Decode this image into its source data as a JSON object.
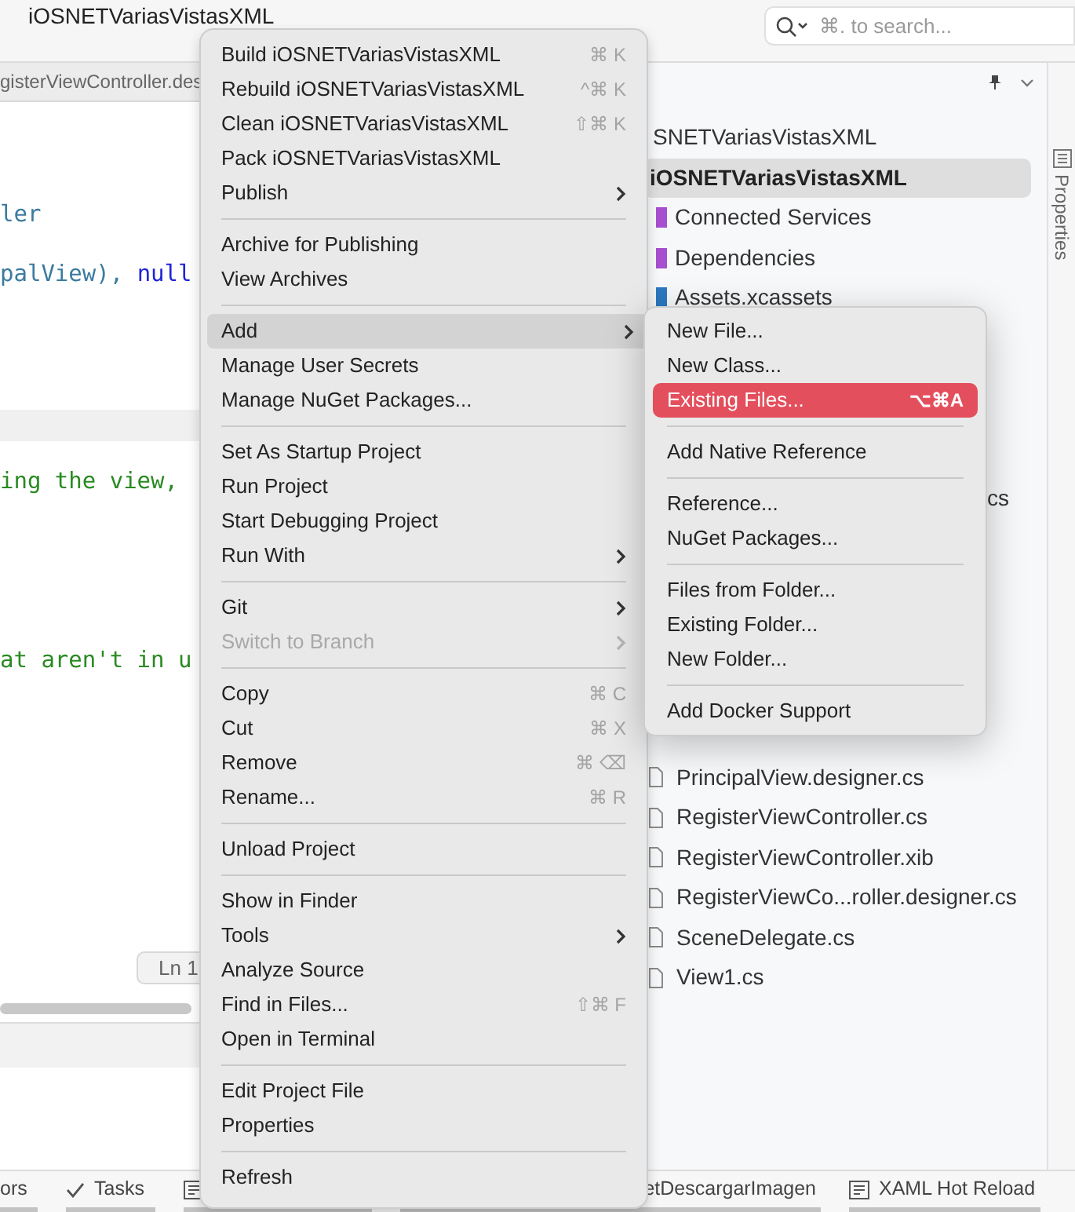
{
  "window": {
    "title": "iOSNETVariasVistasXML"
  },
  "search": {
    "placeholder": "⌘. to search..."
  },
  "editor": {
    "tab": "gisterViewController.des",
    "code_lines": [
      [
        {
          "text": "ler",
          "kind": "type"
        }
      ],
      [
        {
          "text": "palView), ",
          "kind": "type"
        },
        {
          "text": "null",
          "kind": "keyword"
        }
      ],
      [
        {
          "text": "ing the view,",
          "kind": "comment"
        }
      ],
      [
        {
          "text": "at aren't in u",
          "kind": "comment"
        }
      ]
    ],
    "status": "Ln 1"
  },
  "solution": {
    "top": [
      {
        "label": "SNETVariasVistasXML",
        "kind": "root",
        "selected": false
      },
      {
        "label": "iOSNETVariasVistasXML",
        "kind": "project",
        "selected": true
      },
      {
        "label": "Connected Services",
        "kind": "folder",
        "color": "#a64fcf",
        "selected": false
      },
      {
        "label": "Dependencies",
        "kind": "folder",
        "color": "#a64fcf",
        "selected": false
      },
      {
        "label": "Assets.xcassets",
        "kind": "folder",
        "color": "#2c78c0",
        "selected": false
      }
    ],
    "peek": "cs",
    "bottom": [
      {
        "label": "PrincipalView.designer.cs",
        "kind": "file",
        "selected": false
      },
      {
        "label": "RegisterViewController.cs",
        "kind": "file",
        "selected": false
      },
      {
        "label": "RegisterViewController.xib",
        "kind": "file",
        "selected": false
      },
      {
        "label": "RegisterViewCo...roller.designer.cs",
        "kind": "file",
        "selected": false
      },
      {
        "label": "SceneDelegate.cs",
        "kind": "file",
        "selected": false
      },
      {
        "label": "View1.cs",
        "kind": "file",
        "selected": false
      }
    ]
  },
  "properties_label": "Properties",
  "bottom_tabs": [
    {
      "label": "ors",
      "kind": "plain"
    },
    {
      "label": "Tasks",
      "kind": "check"
    },
    {
      "kind": "panel"
    },
    {
      "label": "etDescargarImagen",
      "kind": "plain"
    },
    {
      "label": "XAML Hot Reload",
      "kind": "panel"
    }
  ],
  "context_menu": {
    "items": [
      {
        "kind": "item",
        "label": "Build iOSNETVariasVistasXML",
        "shortcut": "⌘ K",
        "selected": false,
        "disabled": false
      },
      {
        "kind": "item",
        "label": "Rebuild iOSNETVariasVistasXML",
        "shortcut": "^⌘ K",
        "selected": false,
        "disabled": false
      },
      {
        "kind": "item",
        "label": "Clean iOSNETVariasVistasXML",
        "shortcut": "⇧⌘ K",
        "selected": false,
        "disabled": false
      },
      {
        "kind": "item",
        "label": "Pack iOSNETVariasVistasXML",
        "selected": false,
        "disabled": false
      },
      {
        "kind": "item",
        "label": "Publish",
        "submenu": true,
        "selected": false,
        "disabled": false
      },
      {
        "kind": "separator"
      },
      {
        "kind": "item",
        "label": "Archive for Publishing",
        "selected": false,
        "disabled": false
      },
      {
        "kind": "item",
        "label": "View Archives",
        "selected": false,
        "disabled": false
      },
      {
        "kind": "separator"
      },
      {
        "kind": "item",
        "label": "Add",
        "submenu": true,
        "selected": true,
        "disabled": false
      },
      {
        "kind": "item",
        "label": "Manage User Secrets",
        "selected": false,
        "disabled": false
      },
      {
        "kind": "item",
        "label": "Manage NuGet Packages...",
        "selected": false,
        "disabled": false
      },
      {
        "kind": "separator"
      },
      {
        "kind": "item",
        "label": "Set As Startup Project",
        "selected": false,
        "disabled": false
      },
      {
        "kind": "item",
        "label": "Run Project",
        "selected": false,
        "disabled": false
      },
      {
        "kind": "item",
        "label": "Start Debugging Project",
        "selected": false,
        "disabled": false
      },
      {
        "kind": "item",
        "label": "Run With",
        "submenu": true,
        "selected": false,
        "disabled": false
      },
      {
        "kind": "separator"
      },
      {
        "kind": "item",
        "label": "Git",
        "submenu": true,
        "selected": false,
        "disabled": false
      },
      {
        "kind": "item",
        "label": "Switch to Branch",
        "submenu": true,
        "selected": false,
        "disabled": true
      },
      {
        "kind": "separator"
      },
      {
        "kind": "item",
        "label": "Copy",
        "shortcut": "⌘ C",
        "selected": false,
        "disabled": false
      },
      {
        "kind": "item",
        "label": "Cut",
        "shortcut": "⌘ X",
        "selected": false,
        "disabled": false
      },
      {
        "kind": "item",
        "label": "Remove",
        "shortcut": "⌘ ⌫",
        "selected": false,
        "disabled": false
      },
      {
        "kind": "item",
        "label": "Rename...",
        "shortcut": "⌘ R",
        "selected": false,
        "disabled": false
      },
      {
        "kind": "separator"
      },
      {
        "kind": "item",
        "label": "Unload Project",
        "selected": false,
        "disabled": false
      },
      {
        "kind": "separator"
      },
      {
        "kind": "item",
        "label": "Show in Finder",
        "selected": false,
        "disabled": false
      },
      {
        "kind": "item",
        "label": "Tools",
        "submenu": true,
        "selected": false,
        "disabled": false
      },
      {
        "kind": "item",
        "label": "Analyze Source",
        "selected": false,
        "disabled": false
      },
      {
        "kind": "item",
        "label": "Find in Files...",
        "shortcut": "⇧⌘ F",
        "selected": false,
        "disabled": false
      },
      {
        "kind": "item",
        "label": "Open in Terminal",
        "selected": false,
        "disabled": false
      },
      {
        "kind": "separator"
      },
      {
        "kind": "item",
        "label": "Edit Project File",
        "selected": false,
        "disabled": false
      },
      {
        "kind": "item",
        "label": "Properties",
        "selected": false,
        "disabled": false
      },
      {
        "kind": "separator"
      },
      {
        "kind": "item",
        "label": "Refresh",
        "selected": false,
        "disabled": false
      }
    ]
  },
  "submenu": {
    "items": [
      {
        "kind": "item",
        "label": "New File...",
        "selected": false,
        "disabled": false
      },
      {
        "kind": "item",
        "label": "New Class...",
        "selected": false,
        "disabled": false
      },
      {
        "kind": "item",
        "label": "Existing Files...",
        "shortcut": "⌥⌘A",
        "selected": true,
        "disabled": false
      },
      {
        "kind": "separator"
      },
      {
        "kind": "item",
        "label": "Add Native Reference",
        "selected": false,
        "disabled": false
      },
      {
        "kind": "separator"
      },
      {
        "kind": "item",
        "label": "Reference...",
        "selected": false,
        "disabled": false
      },
      {
        "kind": "item",
        "label": "NuGet Packages...",
        "selected": false,
        "disabled": false
      },
      {
        "kind": "separator"
      },
      {
        "kind": "item",
        "label": "Files from Folder...",
        "selected": false,
        "disabled": false
      },
      {
        "kind": "item",
        "label": "Existing Folder...",
        "selected": false,
        "disabled": false
      },
      {
        "kind": "item",
        "label": "New Folder...",
        "selected": false,
        "disabled": false
      },
      {
        "kind": "separator"
      },
      {
        "kind": "item",
        "label": "Add Docker Support",
        "selected": false,
        "disabled": false
      }
    ]
  }
}
